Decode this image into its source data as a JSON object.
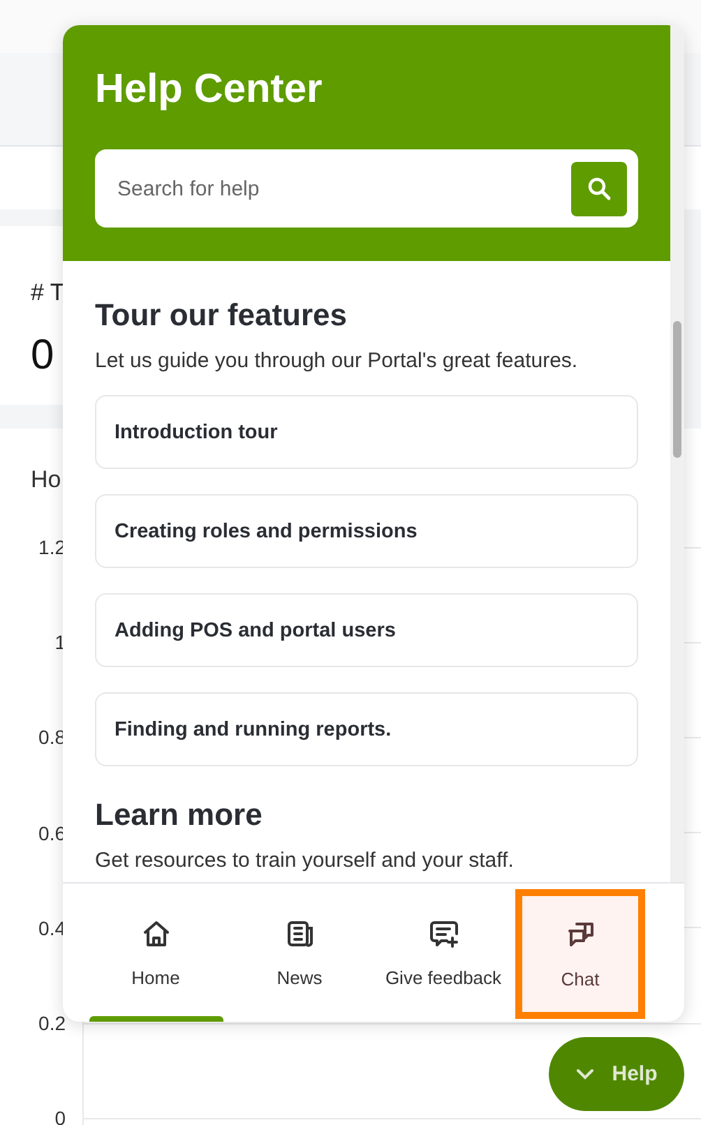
{
  "background": {
    "stat_card": {
      "label": "# T",
      "value": "0"
    },
    "chart": {
      "title": "Ho",
      "y_labels": [
        "1.2",
        "1",
        "0.8",
        "0.6",
        "0.4",
        "0.2",
        "0"
      ]
    }
  },
  "help_panel": {
    "title": "Help Center",
    "search": {
      "placeholder": "Search for help"
    },
    "sections": [
      {
        "heading": "Tour our features",
        "description": "Let us guide you through our Portal's great features.",
        "items": [
          "Introduction tour",
          "Creating roles and permissions",
          "Adding POS and portal users",
          "Finding and running reports."
        ]
      },
      {
        "heading": "Learn more",
        "description": "Get resources to train yourself and your staff."
      }
    ],
    "nav": [
      {
        "label": "Home",
        "kind": "home",
        "selected": true,
        "highlighted": false
      },
      {
        "label": "News",
        "kind": "news",
        "selected": false,
        "highlighted": false
      },
      {
        "label": "Give feedback",
        "kind": "feedback",
        "selected": false,
        "highlighted": false
      },
      {
        "label": "Chat",
        "kind": "chat",
        "selected": false,
        "highlighted": true
      }
    ]
  },
  "help_button": {
    "label": "Help",
    "expanded": true
  }
}
